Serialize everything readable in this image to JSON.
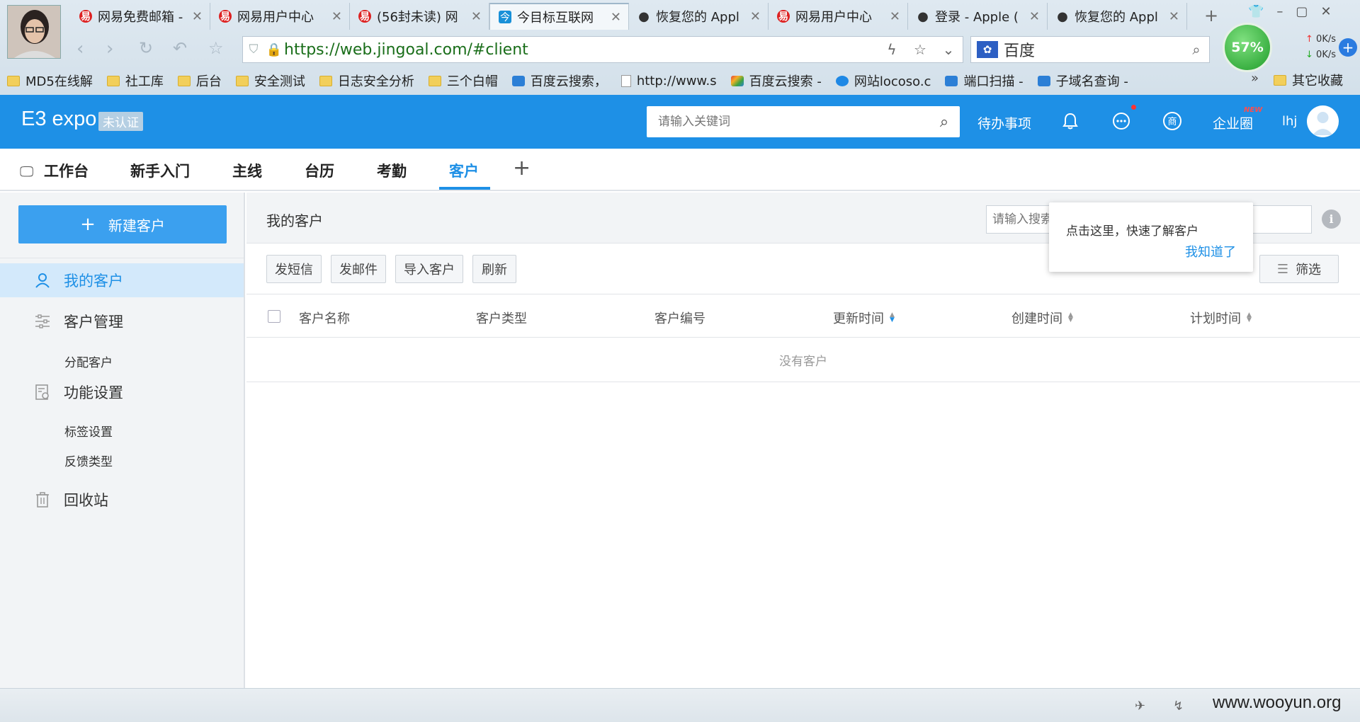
{
  "browser": {
    "tabs": [
      {
        "icon": "netease-icon",
        "title": "网易免费邮箱 -"
      },
      {
        "icon": "netease-icon",
        "title": "网易用户中心"
      },
      {
        "icon": "netease-icon",
        "title": "(56封未读) 网"
      },
      {
        "icon": "jingoal-icon",
        "title": "今目标互联网"
      },
      {
        "icon": "apple-icon",
        "title": "恢复您的 Appl"
      },
      {
        "icon": "netease-icon",
        "title": "网易用户中心"
      },
      {
        "icon": "apple-icon",
        "title": "登录 - Apple ("
      },
      {
        "icon": "apple-icon",
        "title": "恢复您的 Appl"
      }
    ],
    "active_tab": 3,
    "url": "https://web.jingoal.com/#client",
    "search_engine": "百度",
    "cpu_usage": "57%",
    "net_up": "0K/s",
    "net_down": "0K/s",
    "bookmarks": [
      {
        "icon": "folder",
        "label": "MD5在线解"
      },
      {
        "icon": "folder",
        "label": "社工库"
      },
      {
        "icon": "folder",
        "label": "后台"
      },
      {
        "icon": "folder",
        "label": "安全测试"
      },
      {
        "icon": "folder",
        "label": "日志安全分析"
      },
      {
        "icon": "folder",
        "label": "三个白帽"
      },
      {
        "icon": "blue",
        "label": "百度云搜索，"
      },
      {
        "icon": "page",
        "label": "http://www.s"
      },
      {
        "icon": "multi",
        "label": "百度云搜索 -"
      },
      {
        "icon": "a",
        "label": "网站locoso.c"
      },
      {
        "icon": "blue",
        "label": "端口扫描 -"
      },
      {
        "icon": "blue",
        "label": "子域名查询 -"
      }
    ],
    "bookmarks_more": "»",
    "bookmarks_other": "其它收藏"
  },
  "app": {
    "brand": "E3 expo",
    "cert_badge": "未认证",
    "search_placeholder": "请输入关键词",
    "todo": "待办事项",
    "shang": "商",
    "enterprise": "企业圈",
    "new_badge": "NEW",
    "username": "lhj",
    "accent": "#1e90e6"
  },
  "modules": [
    {
      "label": "工作台"
    },
    {
      "label": "新手入门"
    },
    {
      "label": "主线"
    },
    {
      "label": "台历"
    },
    {
      "label": "考勤"
    },
    {
      "label": "客户"
    }
  ],
  "active_module": 5,
  "sidebar": {
    "new_customer": "新建客户",
    "my_customers": "我的客户",
    "customer_mgmt": "客户管理",
    "assign_customer": "分配客户",
    "feature_settings": "功能设置",
    "tag_settings": "标签设置",
    "feedback_types": "反馈类型",
    "recycle_bin": "回收站"
  },
  "main": {
    "title": "我的客户",
    "search_placeholder": "请输入搜索",
    "buttons": {
      "sms": "发短信",
      "email": "发邮件",
      "import": "导入客户",
      "refresh": "刷新",
      "filter": "筛选"
    },
    "columns": [
      "客户名称",
      "客户类型",
      "客户编号",
      "更新时间",
      "创建时间",
      "计划时间"
    ],
    "empty": "没有客户"
  },
  "guide": {
    "text": "点击这里，快速了解客户",
    "ok": "我知道了"
  },
  "status": {
    "watermark": "www.wooyun.org"
  }
}
